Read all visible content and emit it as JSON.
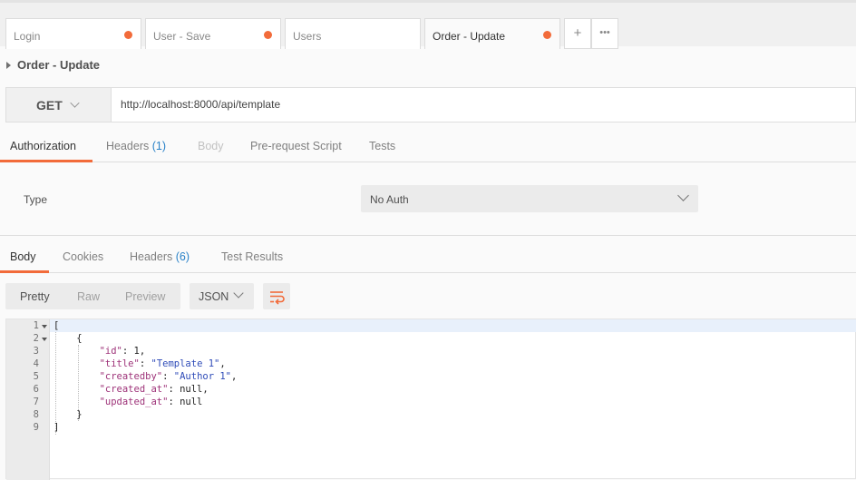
{
  "tabs": [
    {
      "label": "Login",
      "dirty": true
    },
    {
      "label": "User - Save",
      "dirty": true
    },
    {
      "label": "Users",
      "dirty": false
    },
    {
      "label": "Order - Update",
      "dirty": true,
      "active": true
    }
  ],
  "tab_actions": {
    "add": "+",
    "more": "•••"
  },
  "request": {
    "name": "Order - Update",
    "method": "GET",
    "url": "http://localhost:8000/api/template"
  },
  "request_tabs": [
    {
      "label": "Authorization",
      "active": true
    },
    {
      "label": "Headers",
      "count": "(1)"
    },
    {
      "label": "Body",
      "disabled": true
    },
    {
      "label": "Pre-request Script"
    },
    {
      "label": "Tests"
    }
  ],
  "auth": {
    "type_label": "Type",
    "type_value": "No Auth"
  },
  "response_tabs": [
    {
      "label": "Body",
      "active": true
    },
    {
      "label": "Cookies"
    },
    {
      "label": "Headers",
      "count": "(6)"
    },
    {
      "label": "Test Results"
    }
  ],
  "view_modes": [
    "Pretty",
    "Raw",
    "Preview"
  ],
  "format": "JSON",
  "line_numbers": [
    "1",
    "2",
    "3",
    "4",
    "5",
    "6",
    "7",
    "8",
    "9"
  ],
  "code_lines": [
    {
      "segments": [
        [
          "p",
          "["
        ]
      ]
    },
    {
      "segments": [
        [
          "p",
          "    {"
        ]
      ]
    },
    {
      "segments": [
        [
          "p",
          "        "
        ],
        [
          "k",
          "\"id\""
        ],
        [
          "p",
          ": 1,"
        ]
      ]
    },
    {
      "segments": [
        [
          "p",
          "        "
        ],
        [
          "k",
          "\"title\""
        ],
        [
          "p",
          ": "
        ],
        [
          "s",
          "\"Template 1\""
        ],
        [
          "p",
          ","
        ]
      ]
    },
    {
      "segments": [
        [
          "p",
          "        "
        ],
        [
          "k",
          "\"createdby\""
        ],
        [
          "p",
          ": "
        ],
        [
          "s",
          "\"Author 1\""
        ],
        [
          "p",
          ","
        ]
      ]
    },
    {
      "segments": [
        [
          "p",
          "        "
        ],
        [
          "k",
          "\"created_at\""
        ],
        [
          "p",
          ": null,"
        ]
      ]
    },
    {
      "segments": [
        [
          "p",
          "        "
        ],
        [
          "k",
          "\"updated_at\""
        ],
        [
          "p",
          ": null"
        ]
      ]
    },
    {
      "segments": [
        [
          "p",
          "    }"
        ]
      ]
    },
    {
      "segments": [
        [
          "p",
          "]"
        ]
      ]
    }
  ],
  "colors": {
    "accent": "#f26b3a",
    "count": "#2a82c8",
    "json_key": "#9e3379",
    "json_string": "#2e4bb8"
  }
}
